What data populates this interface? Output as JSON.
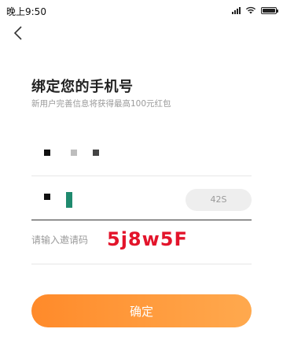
{
  "status_bar": {
    "time": "晚上9:50",
    "battery_level": 1.0
  },
  "header": {
    "back_icon": "chevron-left-icon"
  },
  "page": {
    "title": "绑定您的手机号",
    "subtitle": "新用户完善信息将获得最高100元红包"
  },
  "form": {
    "phone": {
      "masked": true
    },
    "code": {
      "countdown_label": "42S",
      "masked": true
    },
    "invite": {
      "placeholder": "请输入邀请码",
      "code": "5j8w5F"
    },
    "confirm_label": "确定"
  },
  "colors": {
    "accent": "#ff9a3c",
    "invite_code": "#e3142b",
    "countdown_bg": "#eeeeee"
  }
}
